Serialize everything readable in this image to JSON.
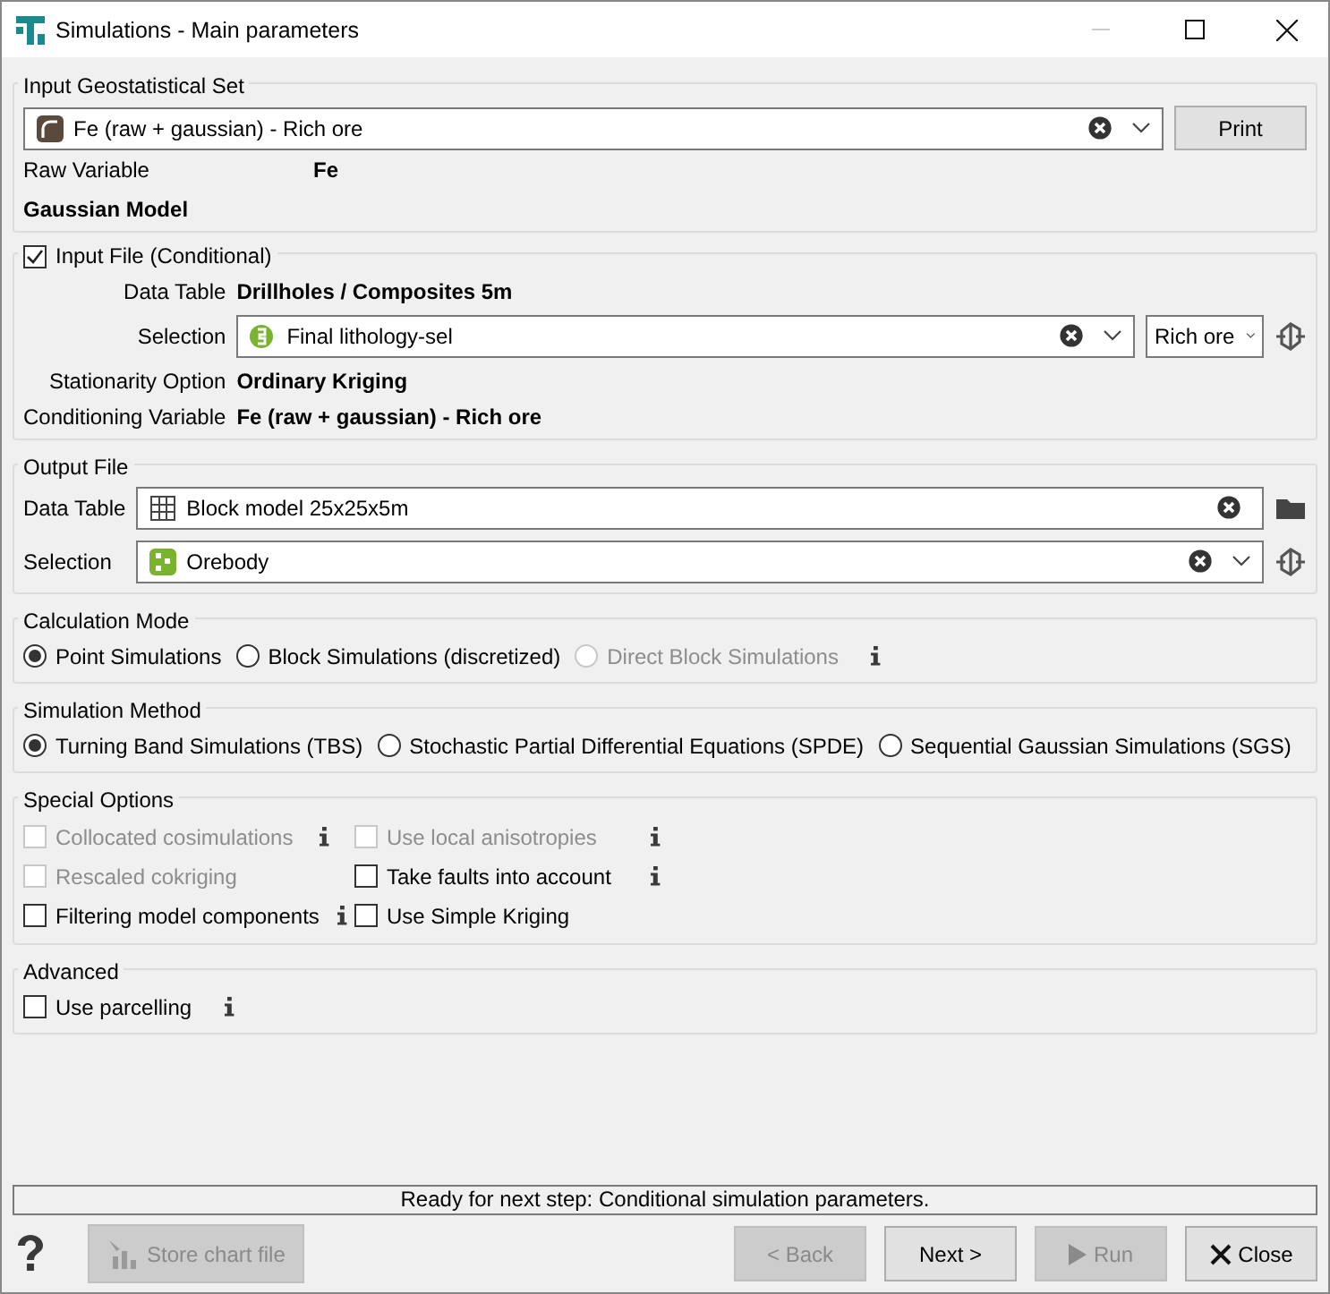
{
  "window": {
    "title": "Simulations - Main parameters"
  },
  "input_set": {
    "title": "Input Geostatistical Set",
    "combo": {
      "value": "Fe (raw + gaussian) - Rich ore"
    },
    "print_button": "Print",
    "raw_variable": {
      "label": "Raw Variable",
      "value": "Fe"
    },
    "gaussian_model": "Gaussian Model"
  },
  "input_file": {
    "title": "Input File (Conditional)",
    "checked": true,
    "data_table": {
      "label": "Data Table",
      "value": "Drillholes / Composites 5m"
    },
    "selection": {
      "label": "Selection",
      "value": "Final lithology-sel",
      "filter": "Rich ore"
    },
    "stationarity": {
      "label": "Stationarity Option",
      "value": "Ordinary Kriging"
    },
    "conditioning": {
      "label": "Conditioning Variable",
      "value": "Fe (raw + gaussian) - Rich ore"
    }
  },
  "output_file": {
    "title": "Output File",
    "data_table": {
      "label": "Data Table",
      "value": "Block model 25x25x5m"
    },
    "selection": {
      "label": "Selection",
      "value": "Orebody"
    }
  },
  "calculation_mode": {
    "title": "Calculation Mode",
    "options": [
      {
        "label": "Point Simulations",
        "selected": true,
        "disabled": false
      },
      {
        "label": "Block Simulations (discretized)",
        "selected": false,
        "disabled": false
      },
      {
        "label": "Direct Block Simulations",
        "selected": false,
        "disabled": true
      }
    ],
    "info": true
  },
  "simulation_method": {
    "title": "Simulation Method",
    "options": [
      {
        "label": "Turning Band Simulations (TBS)",
        "selected": true
      },
      {
        "label": "Stochastic Partial Differential Equations (SPDE)",
        "selected": false
      },
      {
        "label": "Sequential Gaussian Simulations (SGS)",
        "selected": false
      }
    ]
  },
  "special_options": {
    "title": "Special Options",
    "options": [
      {
        "label": "Collocated cosimulations",
        "checked": false,
        "disabled": true,
        "info": true
      },
      {
        "label": "Use local anisotropies",
        "checked": false,
        "disabled": true,
        "info": true
      },
      {
        "label": "Rescaled cokriging",
        "checked": false,
        "disabled": true,
        "info": false
      },
      {
        "label": "Take faults into account",
        "checked": false,
        "disabled": false,
        "info": true
      },
      {
        "label": "Filtering model components",
        "checked": false,
        "disabled": false,
        "info": true
      },
      {
        "label": "Use Simple Kriging",
        "checked": false,
        "disabled": false,
        "info": false
      }
    ]
  },
  "advanced": {
    "title": "Advanced",
    "options": [
      {
        "label": "Use parcelling",
        "checked": false,
        "disabled": false,
        "info": true
      }
    ]
  },
  "status_bar": "Ready for next step: Conditional simulation parameters.",
  "buttons": [
    {
      "kind": "help"
    },
    {
      "kind": "store",
      "label": "Store chart file",
      "disabled": true
    },
    {
      "kind": "back",
      "label": "< Back",
      "disabled": true
    },
    {
      "kind": "next",
      "label": "Next >",
      "disabled": false
    },
    {
      "kind": "run",
      "label": "Run",
      "disabled": true
    },
    {
      "kind": "close",
      "label": "Close",
      "disabled": false
    }
  ]
}
